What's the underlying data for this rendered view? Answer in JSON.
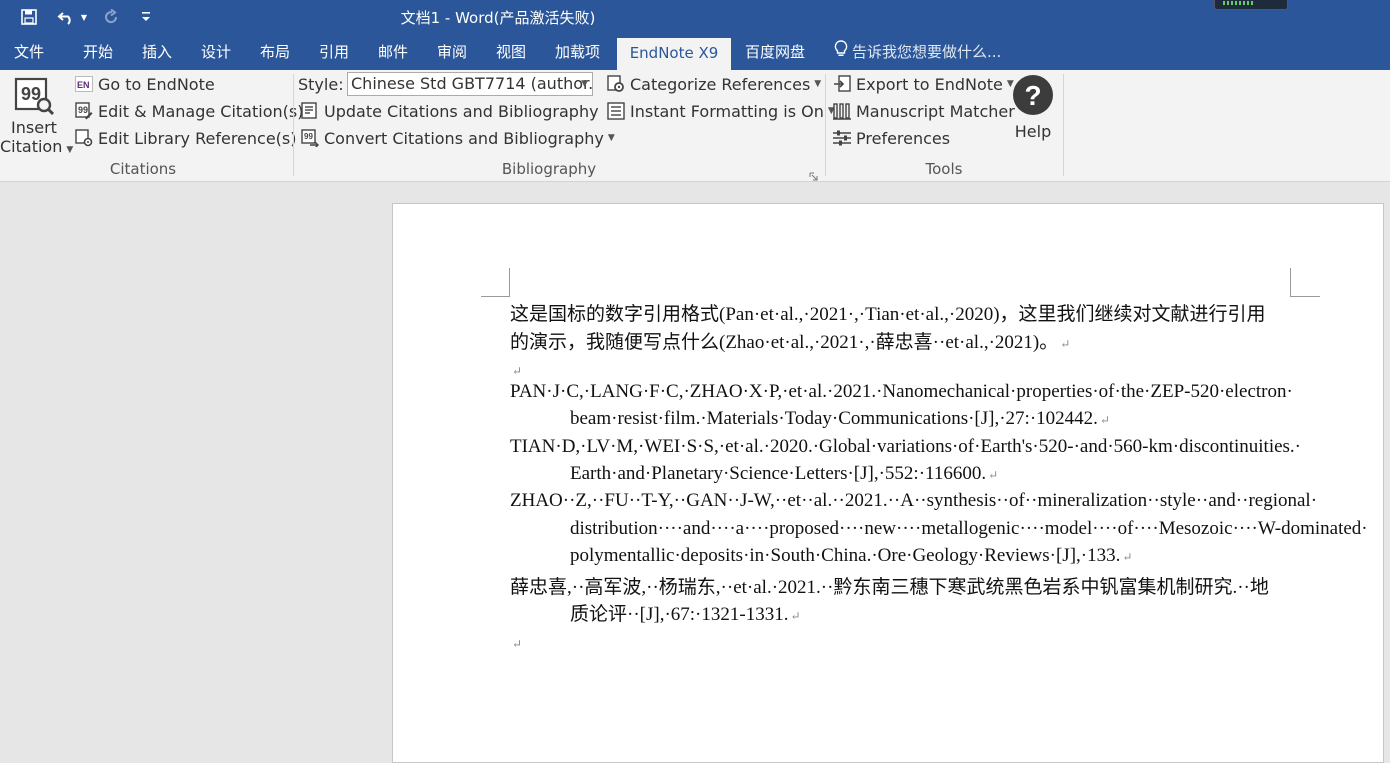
{
  "title": "文档1 - Word(产品激活失败)",
  "quick_access": {
    "save_icon": "save-icon",
    "undo_icon": "undo-icon",
    "redo_icon": "redo-icon",
    "customize_icon": "customize-icon"
  },
  "tabs": [
    "文件",
    "开始",
    "插入",
    "设计",
    "布局",
    "引用",
    "邮件",
    "审阅",
    "视图",
    "加载项",
    "EndNote X9",
    "百度网盘"
  ],
  "active_tab": "EndNote X9",
  "tell_me": "告诉我您想要做什么...",
  "ribbon": {
    "citations": {
      "insert_line1": "Insert",
      "insert_line2": "Citation",
      "go_to": "Go to EndNote",
      "edit_manage": "Edit & Manage Citation(s)",
      "edit_library": "Edit Library Reference(s)",
      "label": "Citations"
    },
    "bibliography": {
      "style_label": "Style:",
      "style_value": "Chinese Std GBT7714 (author...",
      "update": "Update Citations and Bibliography",
      "convert": "Convert Citations and Bibliography",
      "categorize": "Categorize References",
      "instant": "Instant Formatting is On",
      "label": "Bibliography"
    },
    "tools": {
      "export": "Export to EndNote",
      "matcher": "Manuscript Matcher",
      "preferences": "Preferences",
      "help": "Help",
      "label": "Tools"
    }
  },
  "document": {
    "para1_line1": "这是国标的数字引用格式(Pan·et·al.,·2021·,·Tian·et·al.,·2020)，这里我们继续对文献进行引用",
    "para1_line2": "的演示，我随便写点什么(Zhao·et·al.,·2021·,·薛忠喜··et·al.,·2021)。",
    "references": [
      {
        "first": "PAN·J·C,·LANG·F·C,·ZHAO·X·P,·et·al.·2021.·Nanomechanical·properties·of·the·ZEP-520·electron·",
        "rest": [
          "beam·resist·film.·Materials·Today·Communications·[J],·27:·102442."
        ]
      },
      {
        "first": "TIAN·D,·LV·M,·WEI·S·S,·et·al.·2020.·Global·variations·of·Earth's·520-·and·560-km·discontinuities.·",
        "rest": [
          "Earth·and·Planetary·Science·Letters·[J],·552:·116600."
        ]
      },
      {
        "first": "ZHAO··Z,··FU··T-Y,··GAN··J-W,··et··al.··2021.··A··synthesis··of··mineralization··style··and··regional·",
        "rest": [
          "distribution····and····a····proposed····new····metallogenic····model····of····Mesozoic····W-dominated·",
          "polymentallic·deposits·in·South·China.·Ore·Geology·Reviews·[J],·133."
        ]
      },
      {
        "first": "薛忠喜,··高军波,··杨瑞东,··et·al.·2021.··黔东南三穗下寒武统黑色岩系中钒富集机制研究.··地",
        "rest": [
          "质论评··[J],·67:·1321-1331."
        ]
      }
    ],
    "para_mark": "↵"
  }
}
